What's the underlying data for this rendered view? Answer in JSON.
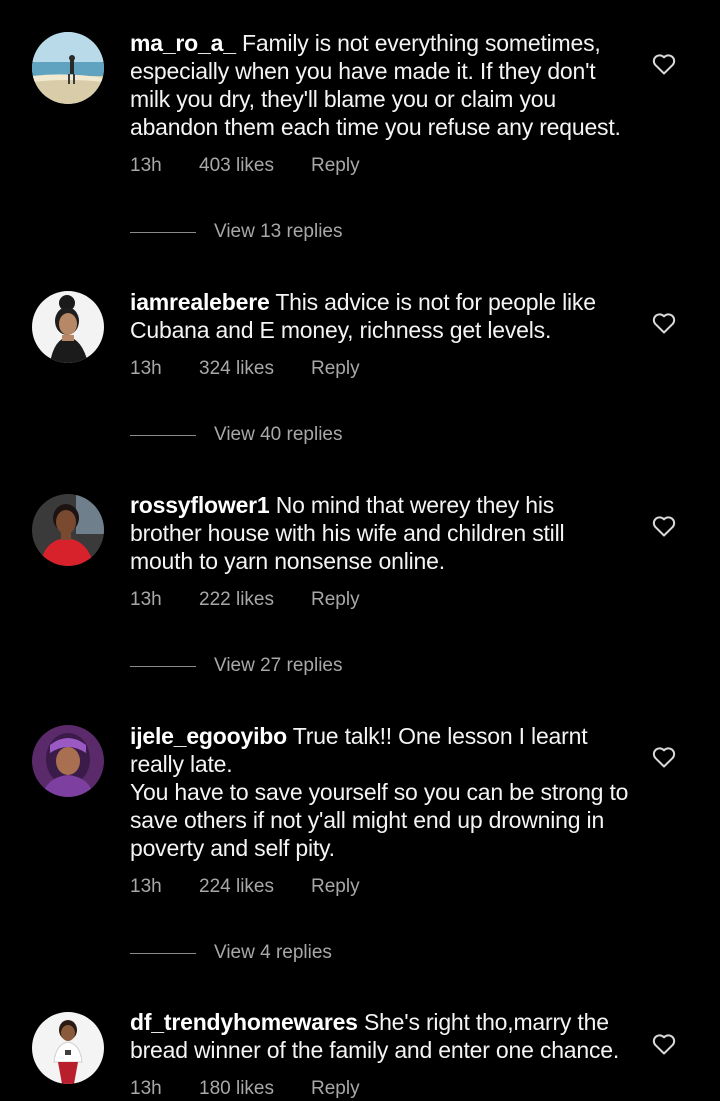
{
  "comments": [
    {
      "username": "ma_ro_a_",
      "text": "Family is not everything sometimes, especially when you have made it. If they don't milk you dry, they'll blame you or claim you abandon them each time you refuse any request.",
      "time": "13h",
      "likes": "403 likes",
      "reply": "Reply",
      "view_replies": "View 13 replies",
      "avatar": "beach-photo"
    },
    {
      "username": "iamrealebere",
      "text": "This advice is not for people like Cubana and E money, richness get levels.",
      "time": "13h",
      "likes": "324 likes",
      "reply": "Reply",
      "view_replies": "View 40 replies",
      "avatar": "woman-white-background"
    },
    {
      "username": "rossyflower1",
      "text": "No mind that werey they his brother house with his wife and children still mouth to yarn nonsense online.",
      "time": "13h",
      "likes": "222 likes",
      "reply": "Reply",
      "view_replies": "View 27 replies",
      "avatar": "woman-red-dress"
    },
    {
      "username": "ijele_egooyibo",
      "text": "True talk!! One lesson I learnt really late.\nYou have to save yourself so you can be strong to save others if not y'all might end up drowning in poverty and self pity.",
      "time": "13h",
      "likes": "224 likes",
      "reply": "Reply",
      "view_replies": "View 4 replies",
      "avatar": "woman-purple-scarf"
    },
    {
      "username": "df_trendyhomewares",
      "text": "She's right tho,marry the bread winner of the family and enter one chance.",
      "time": "13h",
      "likes": "180 likes",
      "reply": "Reply",
      "avatar": "woman-white-top"
    }
  ],
  "colors": {
    "background": "#000000",
    "text": "#f4f4f4",
    "secondary": "#a8a8a8",
    "icon": "#d9d9d9"
  }
}
